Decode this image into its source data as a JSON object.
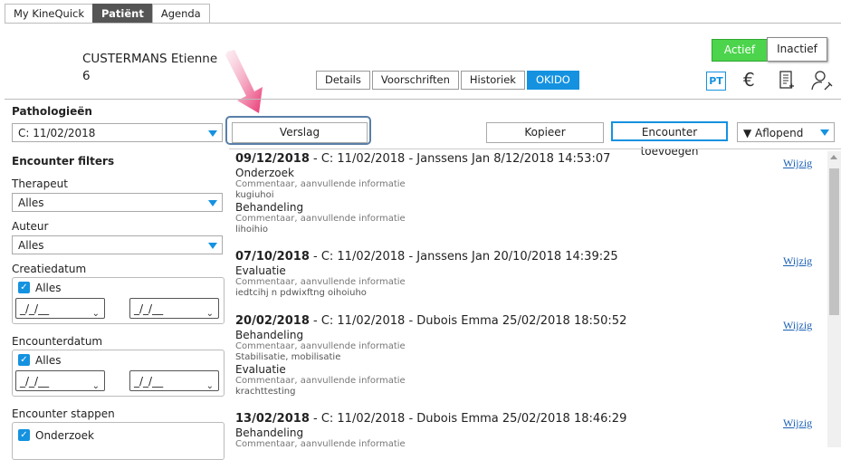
{
  "top_tabs": [
    "My KineQuick",
    "Patiënt",
    "Agenda"
  ],
  "patient": {
    "name": "CUSTERMANS Etienne",
    "number": "6"
  },
  "sub_tabs": [
    "Details",
    "Voorschriften",
    "Historiek",
    "OKIDO"
  ],
  "status": {
    "active_label": "Actief",
    "inactive_label": "Inactief"
  },
  "icons": {
    "pt_label": "PT",
    "euro": "€"
  },
  "left": {
    "pathologies_label": "Pathologieën",
    "pathology_value": "C: 11/02/2018",
    "filters_label": "Encounter filters",
    "therapist_label": "Therapeut",
    "therapist_value": "Alles",
    "author_label": "Auteur",
    "author_value": "Alles",
    "creation_label": "Creatiedatum",
    "creation_all": "Alles",
    "encounter_date_label": "Encounterdatum",
    "encounter_date_all": "Alles",
    "date_placeholder": "_/_/__",
    "steps_label": "Encounter stappen",
    "step_onderzoek": "Onderzoek"
  },
  "toolbar": {
    "verslag": "Verslag",
    "kopieer": "Kopieer",
    "encounter_add": "Encounter toevoegen",
    "sort": "▼ Aflopend"
  },
  "encounters": [
    {
      "date": "09/12/2018",
      "rest": " - C: 11/02/2018 - Janssens Jan 8/12/2018 14:53:07",
      "steps": [
        {
          "name": "Onderzoek",
          "sub": "Commentaar, aanvullende informatie",
          "val": "kugiuhoi"
        },
        {
          "name": "Behandeling",
          "sub": "Commentaar, aanvullende informatie",
          "val": "lihoihio"
        }
      ],
      "edit": "Wijzig"
    },
    {
      "date": "07/10/2018",
      "rest": " - C: 11/02/2018 - Janssens Jan 20/10/2018 14:39:25",
      "steps": [
        {
          "name": "Evaluatie",
          "sub": "Commentaar, aanvullende informatie",
          "val": "iedtcihj n pdwixftng oihoiuho"
        }
      ],
      "edit": "Wijzig"
    },
    {
      "date": "20/02/2018",
      "rest": " - C: 11/02/2018 - Dubois Emma 25/02/2018 18:50:52",
      "steps": [
        {
          "name": "Behandeling",
          "sub": "Commentaar, aanvullende informatie",
          "val": "Stabilisatie, mobilisatie"
        },
        {
          "name": "Evaluatie",
          "sub": "Commentaar, aanvullende informatie",
          "val": "krachttesting"
        }
      ],
      "edit": "Wijzig"
    },
    {
      "date": "13/02/2018",
      "rest": " - C: 11/02/2018 - Dubois Emma 25/02/2018 18:46:29",
      "steps": [
        {
          "name": "Behandeling",
          "sub": "Commentaar, aanvullende informatie",
          "val": ""
        }
      ],
      "edit": "Wijzig"
    }
  ]
}
